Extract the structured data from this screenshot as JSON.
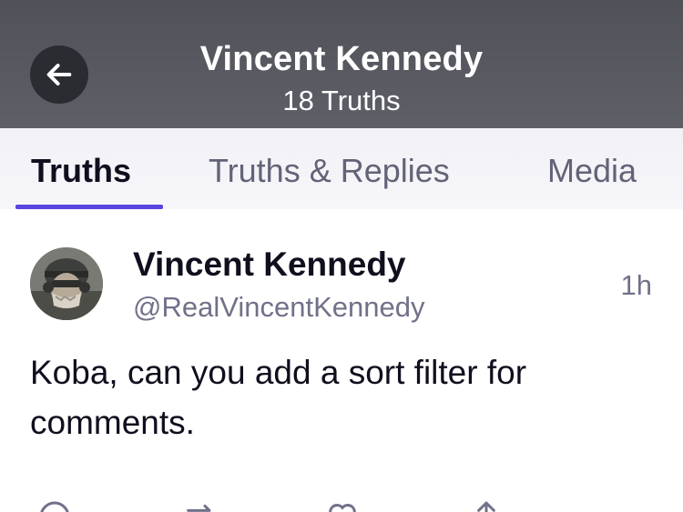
{
  "header": {
    "title": "Vincent Kennedy",
    "subtitle": "18 Truths"
  },
  "tabs": [
    {
      "label": "Truths",
      "active": true
    },
    {
      "label": "Truths & Replies",
      "active": false
    },
    {
      "label": "Media",
      "active": false
    }
  ],
  "post": {
    "author_name": "Vincent Kennedy",
    "author_handle": "@RealVincentKennedy",
    "timestamp": "1h",
    "text": "Koba, can you add a sort filter for comments."
  },
  "icons": {
    "back": "arrow-left-icon",
    "actions": [
      "reply-icon",
      "retruth-icon",
      "like-icon",
      "share-icon"
    ]
  },
  "colors": {
    "header_bg": "#55565e",
    "accent": "#5a44e0",
    "muted_text": "#71718a"
  }
}
